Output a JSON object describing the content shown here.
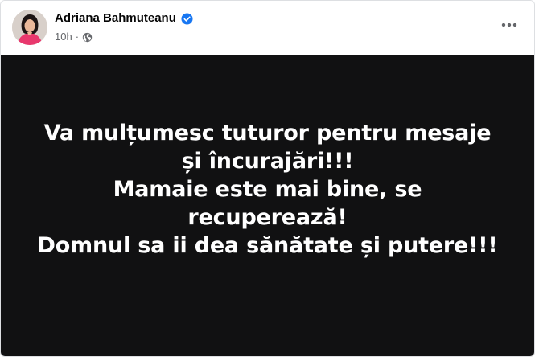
{
  "post": {
    "author": "Adriana Bahmuteanu",
    "verified": true,
    "time": "10h",
    "separator": "·",
    "audience_icon": "globe-icon",
    "more_icon": "more-options-icon",
    "image_text_lines": [
      "Va mulțumesc tuturor pentru mesaje",
      "și încurajări!!!",
      "Mamaie este mai bine, se",
      "recuperează!",
      "Domnul sa ii dea sănătate și putere!!!"
    ]
  },
  "colors": {
    "verified_badge": "#1877f2",
    "image_background": "#111112",
    "image_text": "#ffffff",
    "avatar_outfit": "#e8386d"
  }
}
